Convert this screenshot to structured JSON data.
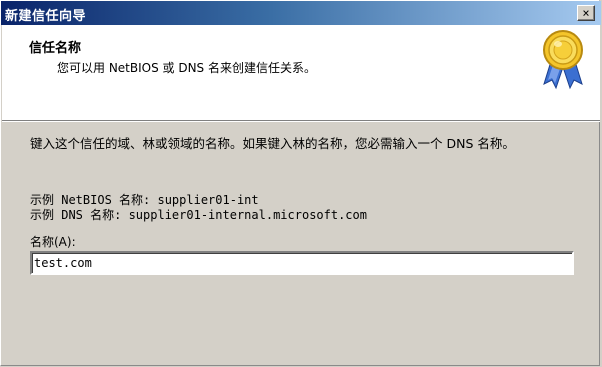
{
  "window": {
    "title": "新建信任向导",
    "close_label": "×"
  },
  "header": {
    "title": "信任名称",
    "subtitle": "您可以用 NetBIOS 或 DNS 名来创建信任关系。",
    "icon": "award-ribbon-icon"
  },
  "body": {
    "instruction": "键入这个信任的域、林或领域的名称。如果键入林的名称，您必需输入一个 DNS 名称。",
    "example_netbios": "示例 NetBIOS 名称: supplier01-int",
    "example_dns": "示例 DNS 名称: supplier01-internal.microsoft.com",
    "name_label": "名称(A):",
    "name_value": "test.com"
  },
  "colors": {
    "titlebar_start": "#0a246a",
    "titlebar_end": "#a6caf0",
    "dialog_bg": "#d4d0c8",
    "header_bg": "#ffffff"
  }
}
